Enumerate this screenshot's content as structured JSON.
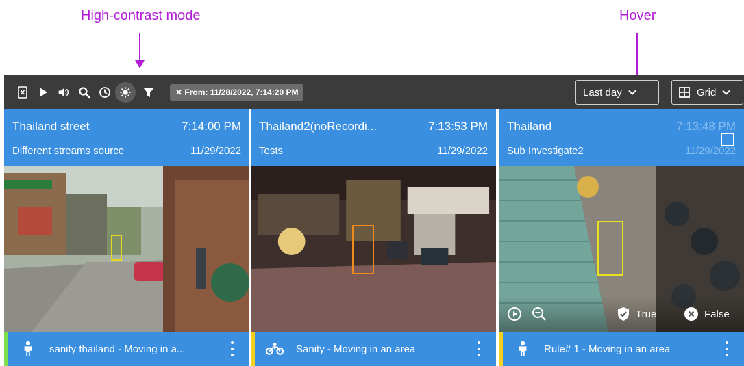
{
  "annotations": {
    "high_contrast": "High-contrast mode",
    "hover": "Hover"
  },
  "toolbar": {
    "icons": [
      "excel-export-icon",
      "play-icon",
      "volume-icon",
      "search-icon",
      "clock-icon",
      "high-contrast-icon",
      "filter-icon"
    ],
    "filter_chip": "✕ From: 11/28/2022, 7:14:20 PM",
    "range_dropdown": "Last day",
    "view_dropdown": "Grid"
  },
  "tiles": [
    {
      "name": "Thailand street",
      "time": "7:14:00 PM",
      "source": "Different streams source",
      "date": "11/29/2022",
      "rule": "sanity thailand - Moving in a...",
      "object_icon": "person-icon",
      "edge_color": "#7be04a",
      "bbox_color": "#e6d81e"
    },
    {
      "name": "Thailand2(noRecordi...",
      "time": "7:13:53 PM",
      "source": "Tests",
      "date": "11/29/2022",
      "rule": "Sanity - Moving in an area",
      "object_icon": "motorcycle-icon",
      "edge_color": "#f2d21f",
      "bbox_color": "#f08a1c"
    },
    {
      "name": "Thailand",
      "time": "7:13:48 PM",
      "source": "Sub Investigate2",
      "date": "11/29/2022",
      "rule": "Rule# 1 - Moving in an area",
      "object_icon": "person-icon",
      "edge_color": "#f2d21f",
      "bbox_color": "#e9e21c",
      "hover": {
        "true_label": "True",
        "false_label": "False"
      }
    }
  ]
}
